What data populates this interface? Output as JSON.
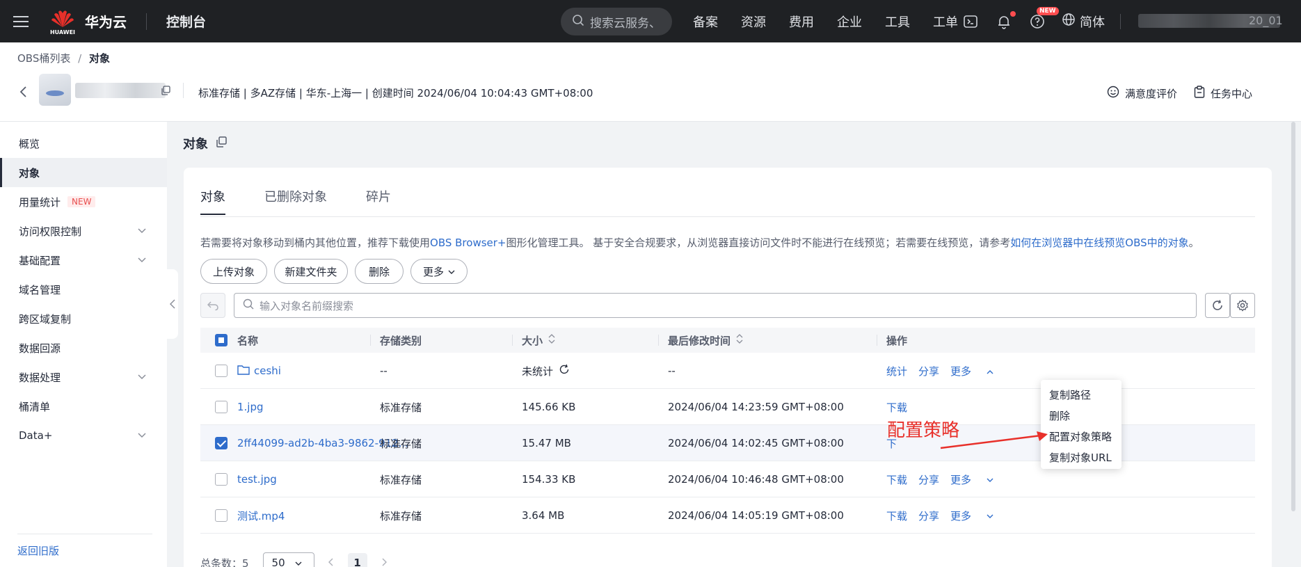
{
  "topbar": {
    "logo_small": "HUAWEI",
    "brand": "华为云",
    "console": "控制台",
    "search_placeholder": "搜索云服务、",
    "links": [
      "备案",
      "资源",
      "费用",
      "企业",
      "工具",
      "工单"
    ],
    "new_badge": "NEW",
    "language": "简体",
    "user_visible_suffix": "20_01"
  },
  "header": {
    "breadcrumb_parent": "OBS桶列表",
    "breadcrumb_sep": "/",
    "breadcrumb_current": "对象",
    "bucket_meta": "标准存储 | 多AZ存储 | 华东-上海一 | 创建时间  2024/06/04 10:04:43 GMT+08:00",
    "right_actions": [
      "满意度评价",
      "任务中心"
    ]
  },
  "sidebar": {
    "items": [
      {
        "label": "概览"
      },
      {
        "label": "对象",
        "active": true
      },
      {
        "label": "用量统计",
        "tag": "NEW"
      },
      {
        "label": "访问权限控制",
        "expandable": true
      },
      {
        "label": "基础配置",
        "expandable": true
      },
      {
        "label": "域名管理"
      },
      {
        "label": "跨区域复制"
      },
      {
        "label": "数据回源"
      },
      {
        "label": "数据处理",
        "expandable": true
      },
      {
        "label": "桶清单"
      },
      {
        "label": "Data+",
        "expandable": true
      }
    ],
    "return_old": "返回旧版"
  },
  "main": {
    "title": "对象",
    "tabs": [
      "对象",
      "已删除对象",
      "碎片"
    ],
    "notice_prefix": "若需要将对象移动到桶内其他位置，推荐下载使用",
    "notice_link1": "OBS Browser+",
    "notice_middle": "图形化管理工具。 基于安全合规要求，从浏览器直接访问文件时不能进行在线预览；若需要在线预览，请参考",
    "notice_link2": "如何在浏览器中在线预览OBS中的对象",
    "notice_suffix": "。",
    "buttons": [
      "上传对象",
      "新建文件夹",
      "删除",
      "更多"
    ],
    "search_placeholder": "输入对象名前缀搜索"
  },
  "table": {
    "columns": [
      "名称",
      "存储类别",
      "大小",
      "最后修改时间",
      "操作"
    ],
    "rows": [
      {
        "name": "ceshi",
        "type": "folder",
        "storage": "--",
        "size": "未统计",
        "modified": "--",
        "ops": [
          "统计",
          "分享",
          "更多"
        ],
        "checked": false
      },
      {
        "name": "1.jpg",
        "type": "file",
        "storage": "标准存储",
        "size": "145.66 KB",
        "modified": "2024/06/04 14:23:59 GMT+08:00",
        "ops": [
          "下载"
        ],
        "checked": false
      },
      {
        "name": "2ff44099-ad2b-4ba3-9862-912...",
        "type": "file",
        "storage": "标准存储",
        "size": "15.47 MB",
        "modified": "2024/06/04 14:02:45 GMT+08:00",
        "ops": [
          "下"
        ],
        "checked": true
      },
      {
        "name": "test.jpg",
        "type": "file",
        "storage": "标准存储",
        "size": "154.33 KB",
        "modified": "2024/06/04 10:46:48 GMT+08:00",
        "ops": [
          "下载",
          "分享",
          "更多"
        ],
        "checked": false
      },
      {
        "name": "测试.mp4",
        "type": "file",
        "storage": "标准存储",
        "size": "3.64 MB",
        "modified": "2024/06/04 14:05:19 GMT+08:00",
        "ops": [
          "下载",
          "分享",
          "更多"
        ],
        "checked": false
      }
    ]
  },
  "dropdown": {
    "items": [
      "复制路径",
      "删除",
      "配置对象策略",
      "复制对象URL"
    ]
  },
  "annotation": {
    "text": "配置策略",
    "color": "#e8302a"
  },
  "pager": {
    "total_label": "总条数：5",
    "page_size": "50",
    "current_page": "1"
  },
  "colors": {
    "accent": "#2e6ccb",
    "topbar": "#1f2124"
  }
}
